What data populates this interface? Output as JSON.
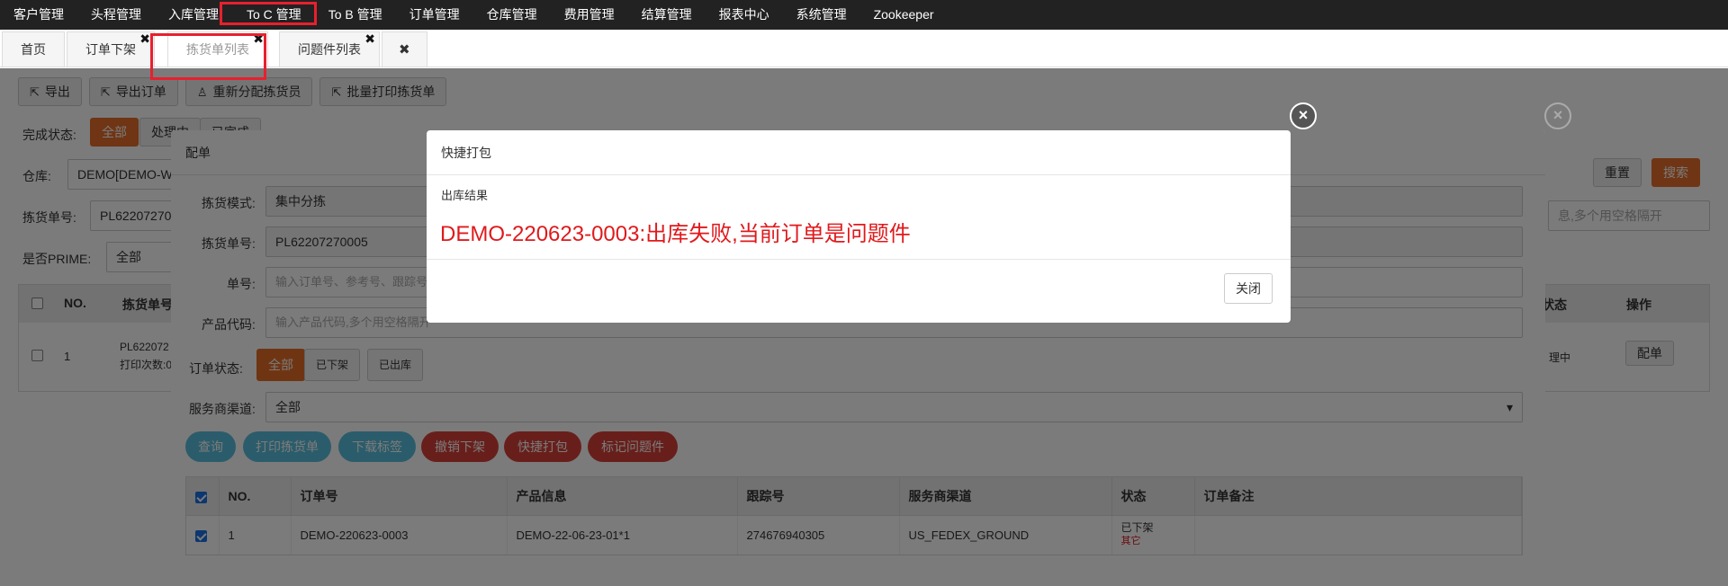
{
  "topnav": {
    "items": [
      "客户管理",
      "头程管理",
      "入库管理",
      "To C 管理",
      "To B 管理",
      "订单管理",
      "仓库管理",
      "费用管理",
      "结算管理",
      "报表中心",
      "系统管理",
      "Zookeeper"
    ]
  },
  "tabs": {
    "items": [
      {
        "label": "首页",
        "closable": false
      },
      {
        "label": "订单下架",
        "closable": true
      },
      {
        "label": "拣货单列表",
        "closable": true,
        "active": true
      },
      {
        "label": "问题件列表",
        "closable": true
      }
    ],
    "close_all": "✖"
  },
  "bg": {
    "toolbar": [
      "导出",
      "导出订单",
      "重新分配拣货员",
      "批量打印拣货单"
    ],
    "status_label": "完成状态:",
    "status_options": [
      "全部",
      "处理中",
      "已完成"
    ],
    "warehouse_label": "仓库:",
    "warehouse_value": "DEMO[DEMO-W",
    "pick_no_label": "拣货单号:",
    "pick_no_value": "PL62207270",
    "prime_label": "是否PRIME:",
    "prime_value": "全部",
    "reset": "重置",
    "search": "搜索",
    "search_placeholder": "息,多个用空格隔开",
    "table_headers": [
      "NO.",
      "拣货单号",
      "状态",
      "操作"
    ],
    "row_no": "1",
    "row_pick": "PL622072",
    "row_print": "打印次数:0",
    "row_status": "理中",
    "row_action": "配单"
  },
  "modal1": {
    "title": "配单",
    "mode_label": "拣货模式:",
    "mode_value": "集中分拣",
    "pick_label": "拣货单号:",
    "pick_value": "PL62207270005",
    "order_label": "单号:",
    "order_placeholder": "输入订单号、参考号、跟踪号",
    "product_label": "产品代码:",
    "product_placeholder": "输入产品代码,多个用空格隔开",
    "order_status_label": "订单状态:",
    "order_status_options": [
      "全部",
      "已下架",
      "已出库"
    ],
    "channel_label": "服务商渠道:",
    "channel_value": "全部",
    "actions": [
      "查询",
      "打印拣货单",
      "下载标签",
      "撤销下架",
      "快捷打包",
      "标记问题件"
    ],
    "table_headers": [
      "NO.",
      "订单号",
      "产品信息",
      "跟踪号",
      "服务商渠道",
      "状态",
      "订单备注"
    ],
    "rows": [
      {
        "no": "1",
        "order": "DEMO-220623-0003",
        "product": "DEMO-22-06-23-01*1",
        "tracking": "274676940305",
        "channel": "US_FEDEX_GROUND",
        "status": "已下架",
        "status_tag": "其它",
        "remark": ""
      }
    ]
  },
  "modal2": {
    "title": "快捷打包",
    "result_label": "出库结果",
    "result_message": "DEMO-220623-0003:出库失败,当前订单是问题件",
    "close": "关闭"
  },
  "colors": {
    "accent": "#e8702a",
    "danger": "#d9423a",
    "info": "#5bc0de",
    "error_text": "#e0191c"
  }
}
